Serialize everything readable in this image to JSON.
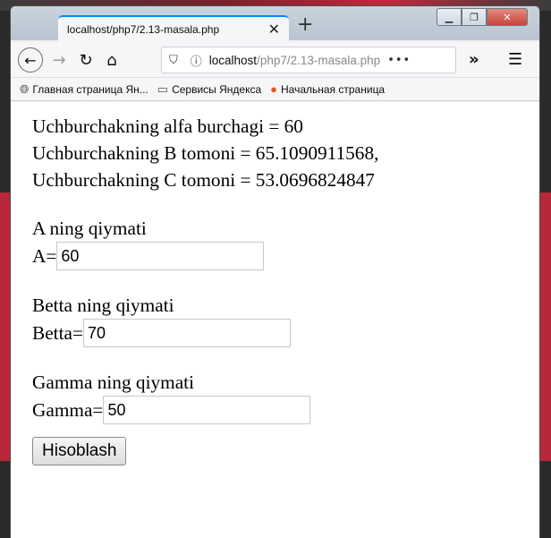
{
  "browser": {
    "tab_title": "localhost/php7/2.13-masala.php",
    "tab_close": "✕",
    "new_tab": "+",
    "url_host": "localhost",
    "url_path": "/php7/2.13-masala.php",
    "url_more": "•••",
    "overflow": "»",
    "menu": "☰",
    "bookmarks": [
      {
        "label": "Главная страница Ян...",
        "icon": "globe-icon"
      },
      {
        "label": "Сервисы Яндекса",
        "icon": "folder-icon"
      },
      {
        "label": "Начальная страница",
        "icon": "firefox-icon"
      }
    ]
  },
  "result": {
    "line1": "Uchburchakning alfa burchagi = 60",
    "line2": "Uchburchakning B tomoni = 65.1090911568,",
    "line3": "Uchburchakning C tomoni = 53.0696824847"
  },
  "form": {
    "a_heading": "A ning qiymati",
    "a_label": "A=",
    "a_value": "60",
    "betta_heading": "Betta ning qiymati",
    "betta_label": "Betta=",
    "betta_value": "70",
    "gamma_heading": "Gamma ning qiymati",
    "gamma_label": "Gamma=",
    "gamma_value": "50",
    "submit_label": "Hisoblash"
  }
}
